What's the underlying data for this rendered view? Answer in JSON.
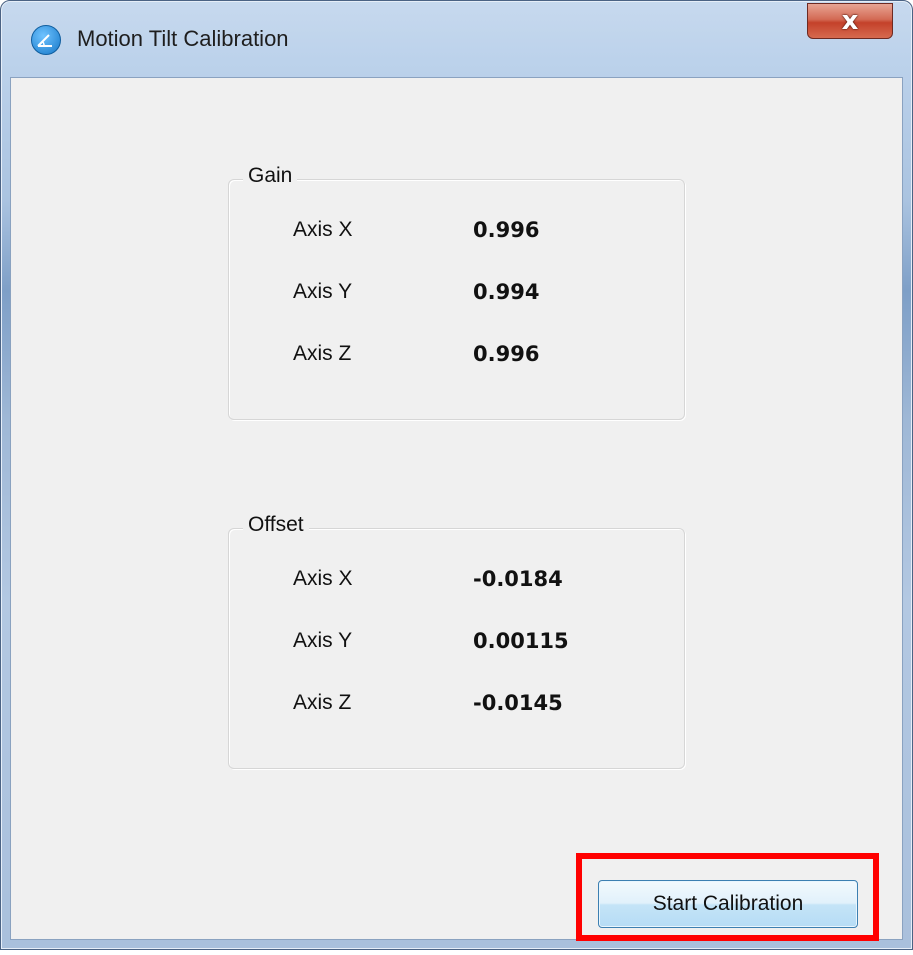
{
  "window": {
    "title": "Motion Tilt Calibration",
    "close_glyph": "x",
    "app_icon": "tilt-angle-icon"
  },
  "gain": {
    "title": "Gain",
    "rows": [
      {
        "label": "Axis X",
        "value": "0.996"
      },
      {
        "label": "Axis Y",
        "value": "0.994"
      },
      {
        "label": "Axis Z",
        "value": "0.996"
      }
    ]
  },
  "offset": {
    "title": "Offset",
    "rows": [
      {
        "label": "Axis X",
        "value": "-0.0184"
      },
      {
        "label": "Axis Y",
        "value": "0.00115"
      },
      {
        "label": "Axis Z",
        "value": "-0.0145"
      }
    ]
  },
  "actions": {
    "start_label": "Start Calibration"
  },
  "colors": {
    "highlight": "#ff0000",
    "close_button": "#c4412a",
    "client_background": "#f0f0f0"
  }
}
